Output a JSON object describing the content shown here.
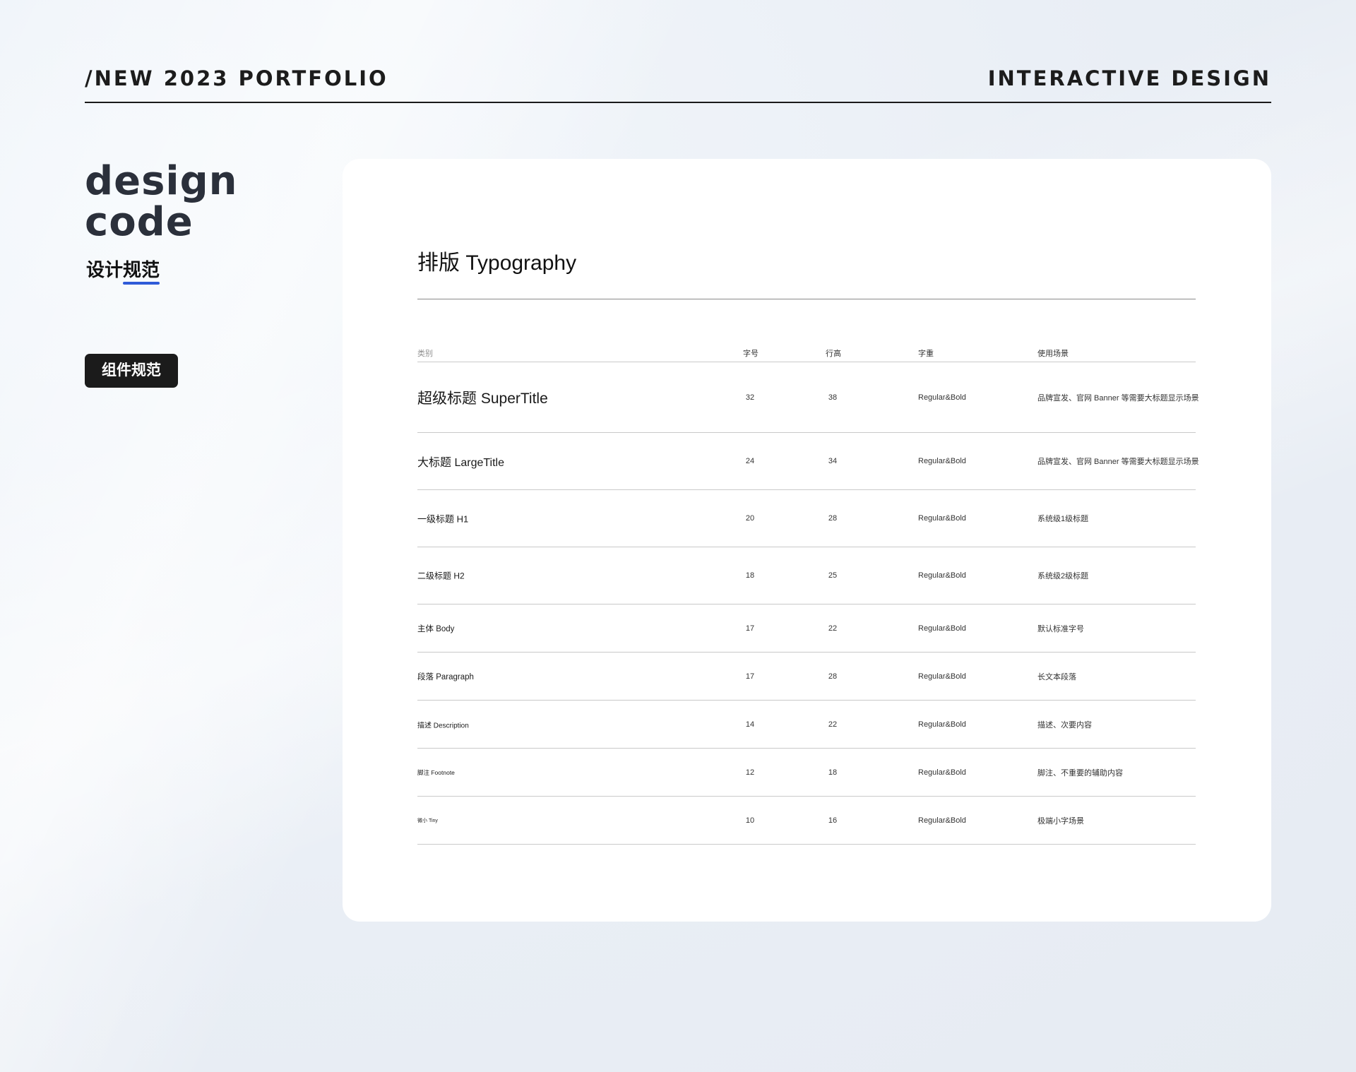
{
  "header": {
    "left": "/NEW 2023 PORTFOLIO",
    "right": "INTERACTIVE DESIGN"
  },
  "sidebar": {
    "title_line1": "design",
    "title_line2": "code",
    "subtitle_a": "设计",
    "subtitle_b": "规范",
    "tag_label": "组件规范"
  },
  "card": {
    "title": "排版 Typography",
    "columns": [
      "类别",
      "字号",
      "行高",
      "字重",
      "使用场景"
    ],
    "rows": [
      {
        "category": "超级标题 SuperTitle",
        "size": "32",
        "line_height": "38",
        "weight": "Regular&Bold",
        "usage": "品牌宣发、官网 Banner 等需要大标题显示场景"
      },
      {
        "category": "大标题 LargeTitle",
        "size": "24",
        "line_height": "34",
        "weight": "Regular&Bold",
        "usage": "品牌宣发、官网 Banner 等需要大标题显示场景"
      },
      {
        "category": "一级标题 H1",
        "size": "20",
        "line_height": "28",
        "weight": "Regular&Bold",
        "usage": "系统级1级标题"
      },
      {
        "category": "二级标题 H2",
        "size": "18",
        "line_height": "25",
        "weight": "Regular&Bold",
        "usage": "系统级2级标题"
      },
      {
        "category": "主体 Body",
        "size": "17",
        "line_height": "22",
        "weight": "Regular&Bold",
        "usage": "默认标准字号"
      },
      {
        "category": "段落 Paragraph",
        "size": "17",
        "line_height": "28",
        "weight": "Regular&Bold",
        "usage": "长文本段落"
      },
      {
        "category": "描述 Description",
        "size": "14",
        "line_height": "22",
        "weight": "Regular&Bold",
        "usage": "描述、次要内容"
      },
      {
        "category": "脚注 Footnote",
        "size": "12",
        "line_height": "18",
        "weight": "Regular&Bold",
        "usage": "脚注、不重要的辅助内容"
      },
      {
        "category": "微小 Tiny",
        "size": "10",
        "line_height": "16",
        "weight": "Regular&Bold",
        "usage": "极端小字场景"
      }
    ]
  }
}
